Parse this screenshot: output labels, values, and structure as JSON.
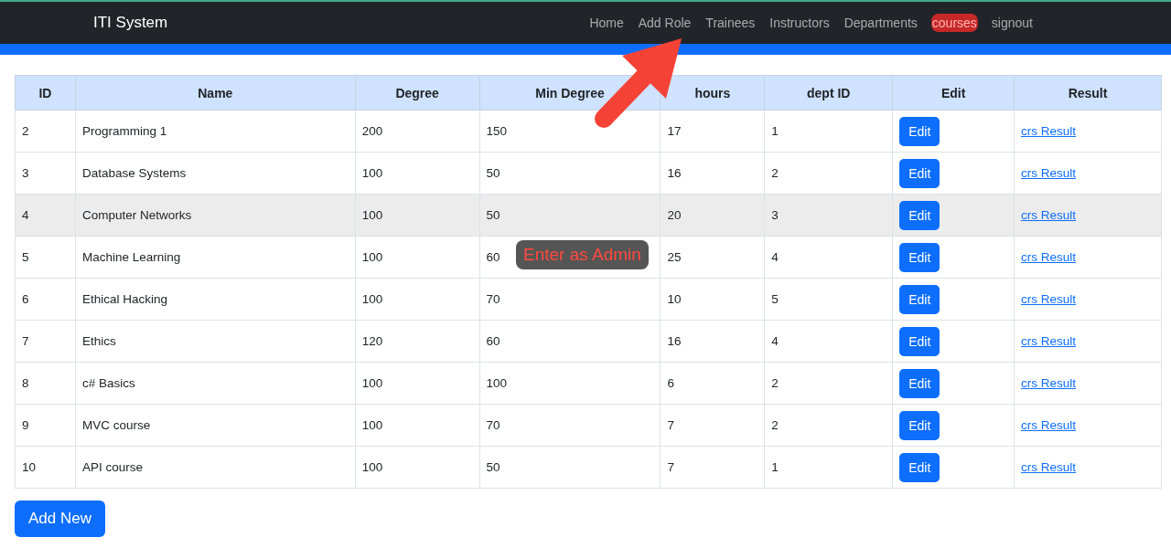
{
  "navbar": {
    "brand": "ITI System",
    "links": [
      {
        "label": "Home",
        "highlighted": false
      },
      {
        "label": "Add Role",
        "highlighted": false
      },
      {
        "label": "Trainees",
        "highlighted": false
      },
      {
        "label": "Instructors",
        "highlighted": false
      },
      {
        "label": "Departments",
        "highlighted": false
      },
      {
        "label": "courses",
        "highlighted": true
      },
      {
        "label": "signout",
        "highlighted": false
      }
    ]
  },
  "table": {
    "columns": [
      "ID",
      "Name",
      "Degree",
      "Min Degree",
      "hours",
      "dept ID",
      "Edit",
      "Result"
    ],
    "rows": [
      {
        "cells": [
          "2",
          "Programming 1",
          "200",
          "150",
          "17",
          "1"
        ],
        "edit": "Edit",
        "result": "crs Result",
        "highlighted": false
      },
      {
        "cells": [
          "3",
          "Database Systems",
          "100",
          "50",
          "16",
          "2"
        ],
        "edit": "Edit",
        "result": "crs Result",
        "highlighted": false
      },
      {
        "cells": [
          "4",
          "Computer Networks",
          "100",
          "50",
          "20",
          "3"
        ],
        "edit": "Edit",
        "result": "crs Result",
        "highlighted": true
      },
      {
        "cells": [
          "5",
          "Machine Learning",
          "100",
          "60",
          "25",
          "4"
        ],
        "edit": "Edit",
        "result": "crs Result",
        "highlighted": false
      },
      {
        "cells": [
          "6",
          "Ethical Hacking",
          "100",
          "70",
          "10",
          "5"
        ],
        "edit": "Edit",
        "result": "crs Result",
        "highlighted": false
      },
      {
        "cells": [
          "7",
          "Ethics",
          "120",
          "60",
          "16",
          "4"
        ],
        "edit": "Edit",
        "result": "crs Result",
        "highlighted": false
      },
      {
        "cells": [
          "8",
          "c# Basics",
          "100",
          "100",
          "6",
          "2"
        ],
        "edit": "Edit",
        "result": "crs Result",
        "highlighted": false
      },
      {
        "cells": [
          "9",
          "MVC course",
          "100",
          "70",
          "7",
          "2"
        ],
        "edit": "Edit",
        "result": "crs Result",
        "highlighted": false
      },
      {
        "cells": [
          "10",
          "API course",
          "100",
          "50",
          "7",
          "1"
        ],
        "edit": "Edit",
        "result": "crs Result",
        "highlighted": false
      }
    ]
  },
  "add_button": "Add New",
  "annotation": {
    "label": "Enter as Admin"
  }
}
